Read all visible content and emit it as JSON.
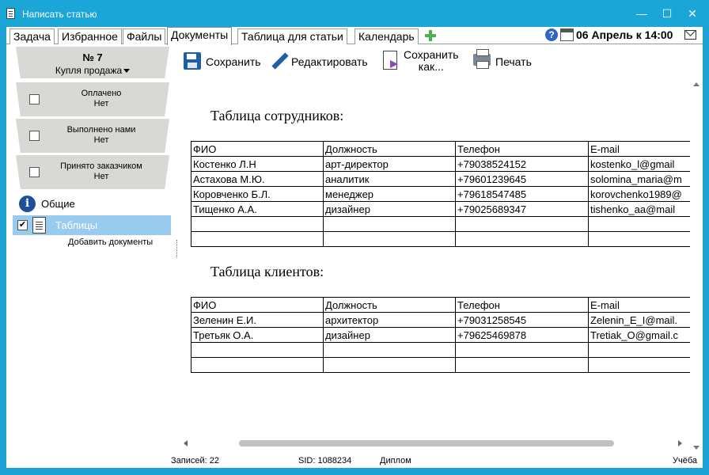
{
  "window": {
    "title": "Написать статью",
    "controls": {
      "minimize": "—",
      "maximize": "☐",
      "close": "✕"
    }
  },
  "tabs": [
    {
      "label": "Задача",
      "active": false
    },
    {
      "label": "Избранное",
      "active": false
    },
    {
      "label": "Файлы",
      "active": false
    },
    {
      "label": "Документы",
      "active": true
    },
    {
      "label": "Таблица для статьи",
      "active": false
    },
    {
      "label": "Календарь",
      "active": false
    }
  ],
  "header_right": {
    "help_icon_glyph": "?",
    "date": "06 Апрель к 14:00"
  },
  "sidebar": {
    "ticket_number": "№ 7",
    "ticket_type": "Купля продажа",
    "statuses": [
      {
        "title": "Оплачено",
        "value": "Нет"
      },
      {
        "title": "Выполнено нами",
        "value": "Нет"
      },
      {
        "title": "Принято заказчиком",
        "value": "Нет"
      }
    ],
    "tree": {
      "general_icon_glyph": "i",
      "general_label": "Общие",
      "tables_check_glyph": "✔",
      "tables_label": "Таблицы",
      "add_documents": "Добавить документы"
    }
  },
  "toolbar": {
    "save": "Сохранить",
    "edit": "Редактировать",
    "save_as_line1": "Сохранить",
    "save_as_line2": "как...",
    "print": "Печать"
  },
  "document": {
    "employees": {
      "title": "Таблица сотрудников:",
      "header": [
        "ФИО",
        "Должность",
        "Телефон",
        "E-mail"
      ],
      "rows": [
        [
          "Костенко Л.Н",
          "арт-директор",
          "+79038524152",
          "kostenko_l@gmail"
        ],
        [
          "Астахова М.Ю.",
          "аналитик",
          "+79601239645",
          "solomina_maria@m"
        ],
        [
          "Коровченко Б.Л.",
          "менеджер",
          "+79618547485",
          "korovchenko1989@"
        ],
        [
          "Тищенко А.А.",
          "дизайнер",
          "+79025689347",
          "tishenko_aa@mail"
        ],
        [
          "",
          "",
          "",
          ""
        ],
        [
          "",
          "",
          "",
          ""
        ]
      ]
    },
    "clients": {
      "title": "Таблица клиентов:",
      "header": [
        "ФИО",
        "Должность",
        "Телефон",
        "E-mail"
      ],
      "rows": [
        [
          "Зеленин Е.И.",
          "архитектор",
          "+79031258545",
          "Zelenin_E_I@mail."
        ],
        [
          "Третьяк О.А.",
          "дизайнер",
          "+79625469878",
          "Tretiak_O@gmail.c"
        ],
        [
          "",
          "",
          "",
          ""
        ],
        [
          "",
          "",
          "",
          ""
        ]
      ]
    }
  },
  "statusbar": {
    "records": "Записей: 22",
    "sid": "SID: 1088234",
    "diploma": "Диплом",
    "study": "Учёба"
  }
}
